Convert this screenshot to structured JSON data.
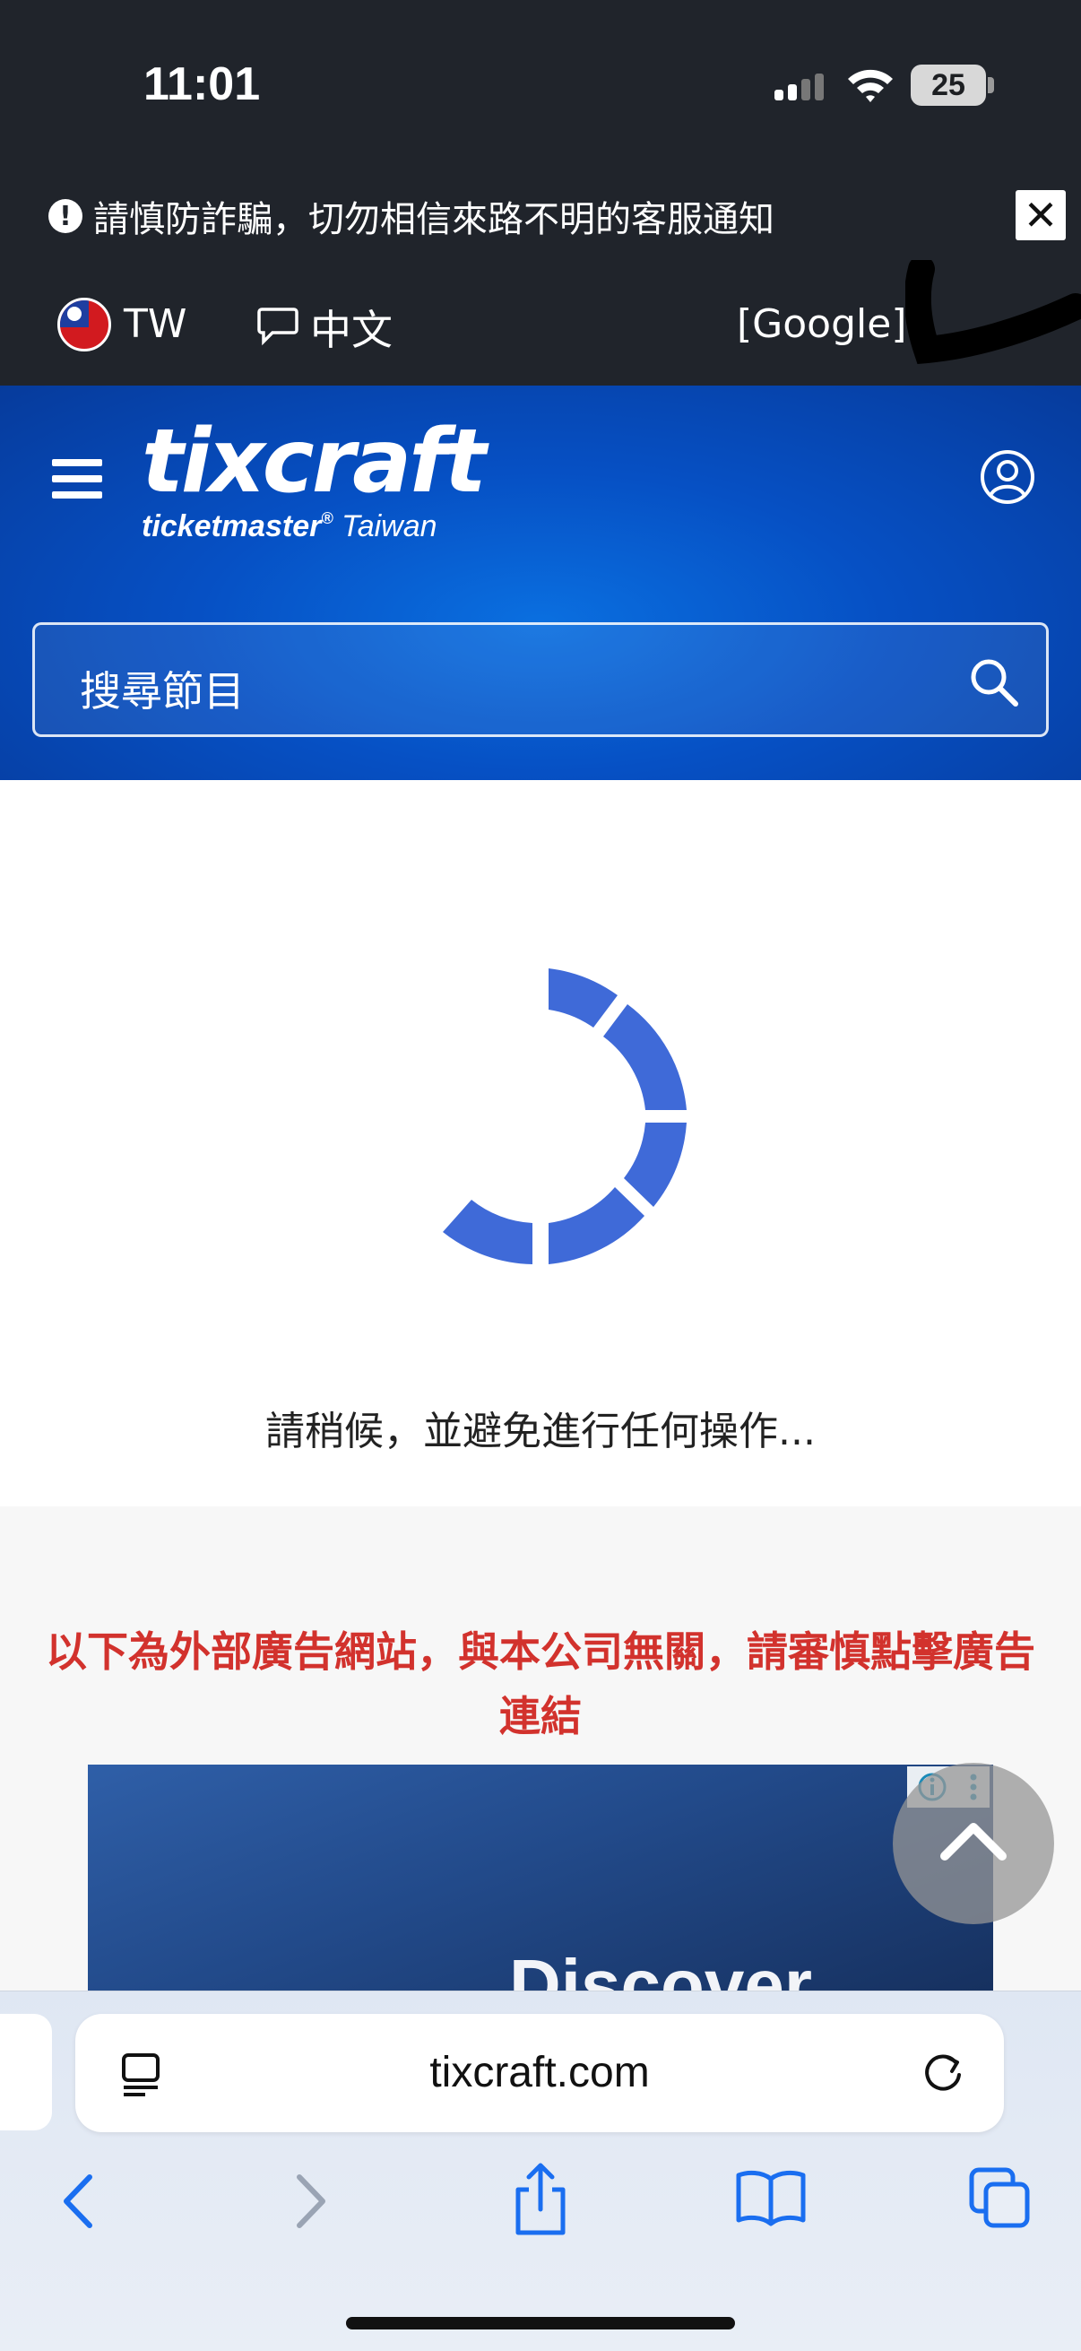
{
  "status_bar": {
    "time": "11:01",
    "battery": "25"
  },
  "banner": {
    "warning_text": "請慎防詐騙，切勿相信來路不明的客服通知",
    "close_label": "✕"
  },
  "lang_bar": {
    "region": "TW",
    "language": "中文",
    "translate": "[Google]"
  },
  "header": {
    "logo_main": "tixcraft",
    "logo_sub": "ticketmaster",
    "logo_region": "Taiwan",
    "search_placeholder": "搜尋節目"
  },
  "loading": {
    "message": "請稍候，並避免進行任何操作..."
  },
  "ad": {
    "notice": "以下為外部廣告網站，與本公司無關，請審慎點擊廣告連結",
    "banner_text": "Discover"
  },
  "browser": {
    "url": "tixcraft.com"
  },
  "colors": {
    "accent_blue": "#0650c4",
    "warning_red": "#d2322d",
    "spinner": "#3f6ad8",
    "dark_bar": "#20242b"
  },
  "icons": [
    "signal-icon",
    "wifi-icon",
    "battery-icon",
    "warning-icon",
    "close-icon",
    "flag-icon",
    "chat-icon",
    "menu-icon",
    "user-icon",
    "search-icon",
    "info-icon",
    "more-icon",
    "chevron-up-icon",
    "reader-icon",
    "reload-icon",
    "back-icon",
    "forward-icon",
    "share-icon",
    "bookmarks-icon",
    "tabs-icon"
  ]
}
